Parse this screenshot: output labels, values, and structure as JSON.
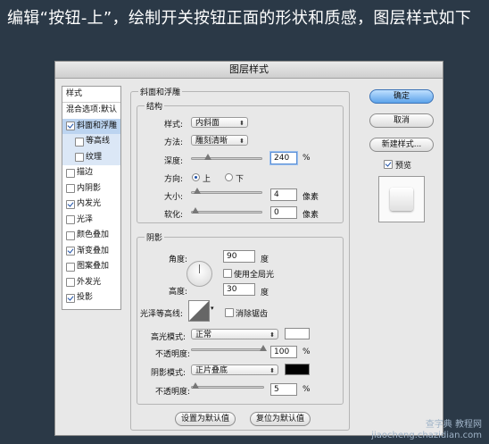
{
  "heading": "编辑“按钮-上”，绘制开关按钮正面的形状和质感，图层样式如下",
  "dialog_title": "图层样式",
  "sidebar": {
    "header": "样式",
    "blend": "混合选项:默认",
    "items": [
      {
        "label": "斜面和浮雕",
        "checked": true,
        "selected": true
      },
      {
        "label": "等高线",
        "checked": false,
        "sub": true
      },
      {
        "label": "纹理",
        "checked": false,
        "sub": true
      },
      {
        "label": "描边",
        "checked": false
      },
      {
        "label": "内阴影",
        "checked": false
      },
      {
        "label": "内发光",
        "checked": true
      },
      {
        "label": "光泽",
        "checked": false
      },
      {
        "label": "颜色叠加",
        "checked": false
      },
      {
        "label": "渐变叠加",
        "checked": true
      },
      {
        "label": "图案叠加",
        "checked": false
      },
      {
        "label": "外发光",
        "checked": false
      },
      {
        "label": "投影",
        "checked": true
      }
    ]
  },
  "bevel": {
    "group_title": "斜面和浮雕",
    "structure_title": "结构",
    "style_label": "样式:",
    "style_value": "内斜面",
    "technique_label": "方法:",
    "technique_value": "雕刻清晰",
    "depth_label": "深度:",
    "depth_value": "240",
    "depth_unit": "%",
    "direction_label": "方向:",
    "dir_up": "上",
    "dir_down": "下",
    "size_label": "大小:",
    "size_value": "4",
    "size_unit": "像素",
    "soften_label": "软化:",
    "soften_value": "0",
    "soften_unit": "像素"
  },
  "shading": {
    "title": "阴影",
    "angle_label": "角度:",
    "angle_value": "90",
    "angle_unit": "度",
    "global_light_label": "使用全局光",
    "altitude_label": "高度:",
    "altitude_value": "30",
    "altitude_unit": "度",
    "gloss_label": "光泽等高线:",
    "antialias_label": "消除锯齿",
    "highlight_label": "高光模式:",
    "highlight_value": "正常",
    "highlight_color": "#ffffff",
    "hl_opacity_label": "不透明度:",
    "hl_opacity_value": "100",
    "hl_opacity_unit": "%",
    "shadow_label": "阴影模式:",
    "shadow_value": "正片叠底",
    "shadow_color": "#000000",
    "sh_opacity_label": "不透明度:",
    "sh_opacity_value": "5",
    "sh_opacity_unit": "%"
  },
  "footer": {
    "make_default": "设置为默认值",
    "reset_default": "复位为默认值"
  },
  "buttons": {
    "ok": "确定",
    "cancel": "取消",
    "new_style": "新建样式...",
    "preview_label": "预览"
  },
  "watermark": "查字典 教程网\njiaocheng.chazidian.com"
}
